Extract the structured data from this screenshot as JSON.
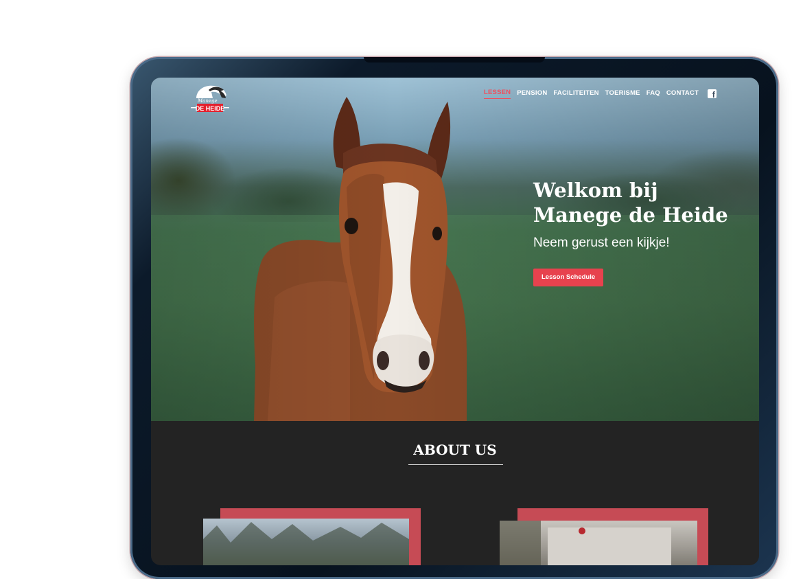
{
  "logo": {
    "line1": "Manege",
    "line2": "DE HEIDE"
  },
  "nav": {
    "items": [
      {
        "label": "LESSEN",
        "active": true
      },
      {
        "label": "PENSION",
        "active": false
      },
      {
        "label": "FACILITEITEN",
        "active": false
      },
      {
        "label": "TOERISME",
        "active": false
      },
      {
        "label": "FAQ",
        "active": false
      },
      {
        "label": "CONTACT",
        "active": false
      }
    ],
    "social_icon": "facebook-icon"
  },
  "hero": {
    "title_line1": "Welkom bij",
    "title_line2": "Manege de Heide",
    "subtitle": "Neem gerust een kijkje!",
    "button_label": "Lesson Schedule"
  },
  "about": {
    "title": "ABOUT US"
  },
  "colors": {
    "accent": "#e7424e",
    "card_accent": "#c64b55",
    "section_bg": "#232323"
  }
}
